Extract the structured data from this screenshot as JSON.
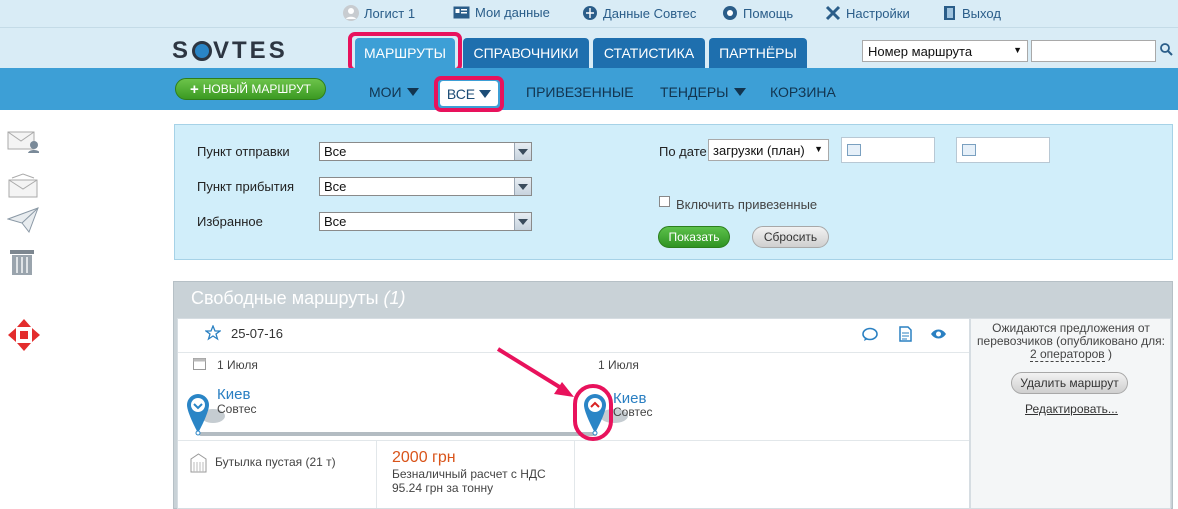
{
  "top_links": {
    "user": "Логист 1",
    "my_data": "Мои данные",
    "sovtes_data": "Данные Совтес",
    "help": "Помощь",
    "settings": "Настройки",
    "exit": "Выход"
  },
  "logo": {
    "text_left": "S",
    "text_right": "VTES"
  },
  "main_tabs": {
    "routes": "МАРШРУТЫ",
    "references": "СПРАВОЧНИКИ",
    "statistics": "СТАТИСТИКА",
    "partners": "ПАРТНЁРЫ"
  },
  "search": {
    "select_value": "Номер маршрута",
    "input_value": ""
  },
  "subnav": {
    "new_route": "НОВЫЙ МАРШРУТ",
    "mine": "МОИ",
    "all": "ВСЕ",
    "delivered": "ПРИВЕЗЕННЫЕ",
    "tenders": "ТЕНДЕРЫ",
    "basket": "КОРЗИНА"
  },
  "filter": {
    "departure_label": "Пункт отправки",
    "departure_value": "Все",
    "arrival_label": "Пункт прибытия",
    "arrival_value": "Все",
    "favorite_label": "Избранное",
    "favorite_value": "Все",
    "by_date_label": "По дате",
    "by_date_value": "загрузки (план)",
    "date_from": "",
    "date_to": "",
    "include_delivered": "Включить привезенные",
    "show_button": "Показать",
    "reset_button": "Сбросить"
  },
  "routes_panel": {
    "title": "Свободные маршруты",
    "count": "(1)"
  },
  "route": {
    "date": "25-07-16",
    "from_date": "1 Июля",
    "to_date": "1 Июля",
    "from_city": "Киев",
    "from_company": "Совтес",
    "to_city": "Киев",
    "to_company": "Совтес",
    "cargo": "Бутылка пустая (21 т)",
    "price": "2000 грн",
    "payment": "Безналичный расчет с НДС",
    "per_ton": "95.24 грн за тонну",
    "offers_text_1": "Ожидаются предложения от",
    "offers_text_2": "перевозчиков (опубликовано для:",
    "offers_link": "2 операторов",
    "offers_close": ")",
    "delete_button": "Удалить маршрут",
    "edit_link": "Редактировать..."
  },
  "colors": {
    "accent": "#3d9fd6",
    "tab_dark": "#1e6fae",
    "highlight": "#e8125c",
    "price": "#d9541a",
    "link": "#2a5d89"
  },
  "icons": [
    "user-icon",
    "card-icon",
    "globe-icon",
    "help-icon",
    "tools-icon",
    "exit-icon",
    "search-icon",
    "mail-user-icon",
    "mail-icon",
    "paper-plane-icon",
    "trash-icon",
    "move-arrows-icon",
    "star-icon",
    "calendar-icon",
    "comment-icon",
    "document-icon",
    "eye-icon",
    "map-pin-icon",
    "warehouse-icon"
  ]
}
